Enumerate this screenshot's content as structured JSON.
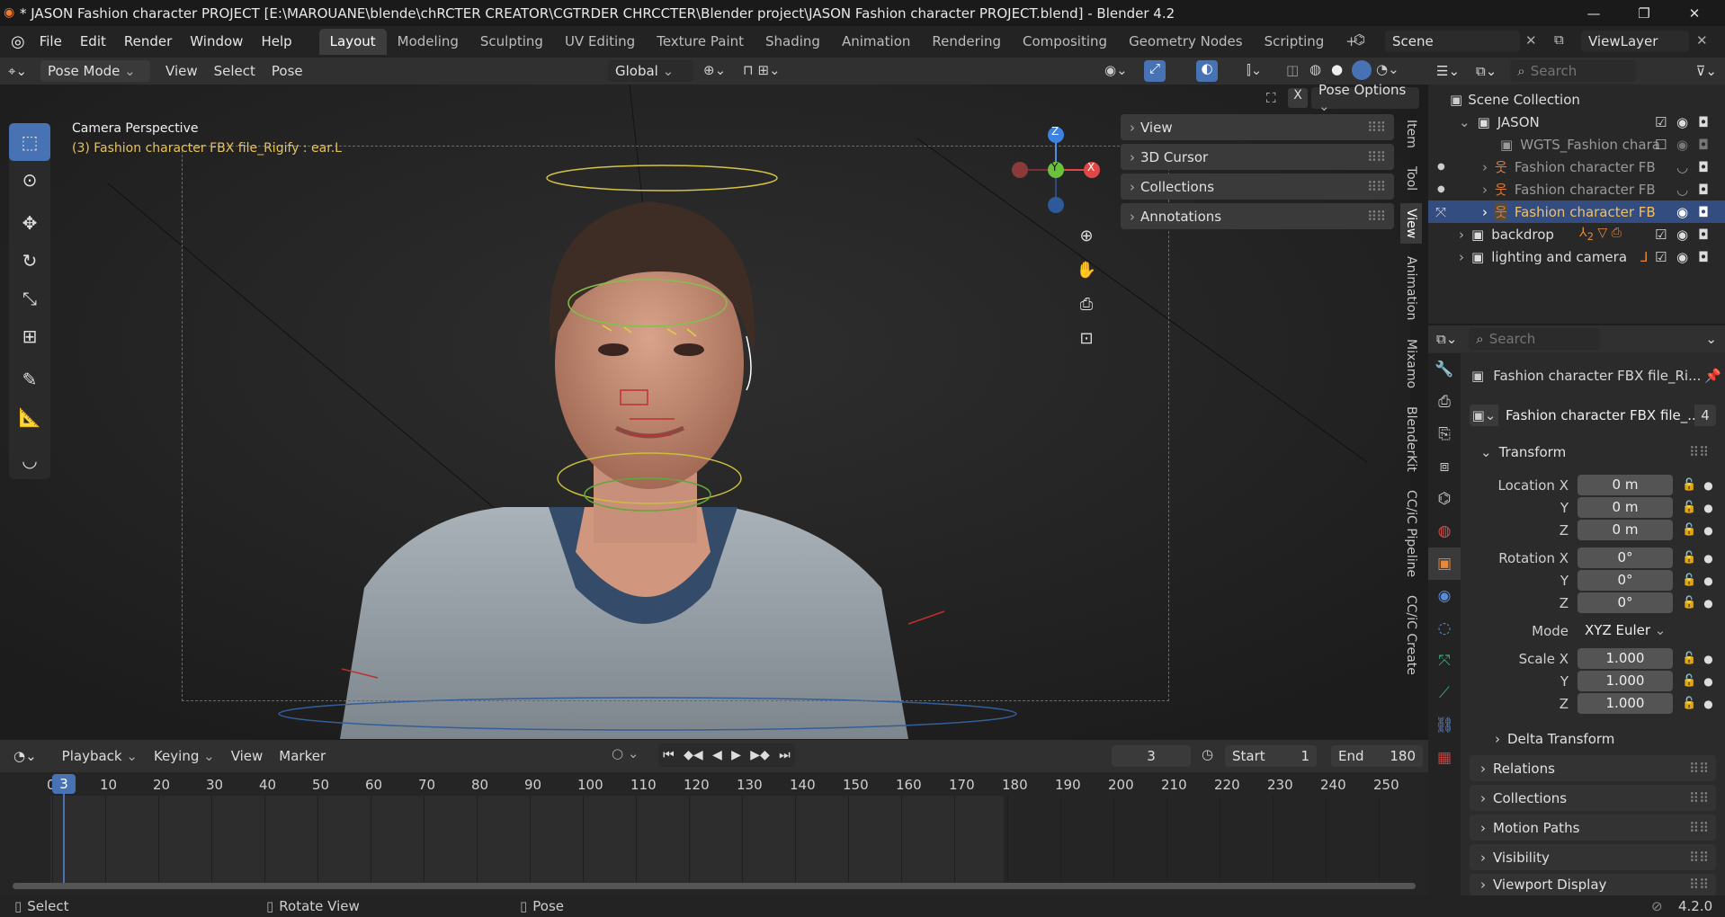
{
  "title": "* JASON Fashion character PROJECT [E:\\MAROUANE\\blende\\chRCTER CREATOR\\CGTRDER CHRCCTER\\Blender project\\JASON Fashion character PROJECT.blend] - Blender 4.2",
  "menu": [
    "File",
    "Edit",
    "Render",
    "Window",
    "Help"
  ],
  "workspaces": [
    "Layout",
    "Modeling",
    "Sculpting",
    "UV Editing",
    "Texture Paint",
    "Shading",
    "Animation",
    "Rendering",
    "Compositing",
    "Geometry Nodes",
    "Scripting"
  ],
  "scene_name": "Scene",
  "viewlayer_name": "ViewLayer",
  "viewport_header": {
    "mode": "Pose Mode",
    "view": "View",
    "select": "Select",
    "pose": "Pose",
    "orientation": "Global",
    "search_placeholder": "Search",
    "pose_options": "Pose Options"
  },
  "viewport": {
    "camera_label": "Camera Perspective",
    "active_label": "(3) Fashion character FBX file_Rigify : ear.L"
  },
  "gizmo": {
    "z": "Z",
    "y": "Y",
    "x": "X"
  },
  "npanel_sections": [
    "View",
    "3D Cursor",
    "Collections",
    "Annotations"
  ],
  "side_tabs": [
    "Item",
    "Tool",
    "View",
    "Animation",
    "Mixamo",
    "BlenderKit",
    "CC/iC Pipeline",
    "CC/iC Create"
  ],
  "outliner": {
    "search_placeholder": "Search",
    "root": "Scene Collection",
    "rows": [
      {
        "label": "JASON",
        "indent": 1
      },
      {
        "label": "WGTS_Fashion chara",
        "indent": 2
      },
      {
        "label": "Fashion character FB",
        "indent": 2
      },
      {
        "label": "Fashion character FB",
        "indent": 2
      },
      {
        "label": "Fashion character FB",
        "indent": 2
      },
      {
        "label": "backdrop",
        "indent": 1
      },
      {
        "label": "lighting and camera",
        "indent": 1
      }
    ],
    "backdrop_badge": "2"
  },
  "properties": {
    "search_placeholder": "Search",
    "object_name": "Fashion character FBX file_Ri...",
    "data_name": "Fashion character FBX file_...",
    "users": "4",
    "transform_label": "Transform",
    "location_label": "Location X",
    "location": [
      "0 m",
      "0 m",
      "0 m"
    ],
    "rotation_label": "Rotation X",
    "rotation": [
      "0°",
      "0°",
      "0°"
    ],
    "mode_label": "Mode",
    "mode_value": "XYZ Euler",
    "scale_label": "Scale X",
    "scale": [
      "1.000",
      "1.000",
      "1.000"
    ],
    "axis_y": "Y",
    "axis_z": "Z",
    "sections": [
      "Delta Transform",
      "Relations",
      "Collections",
      "Motion Paths",
      "Visibility",
      "Viewport Display"
    ]
  },
  "timeline": {
    "playback": "Playback",
    "keying": "Keying",
    "view": "View",
    "marker": "Marker",
    "current_frame": "3",
    "start_label": "Start",
    "start": "1",
    "end_label": "End",
    "end": "180",
    "ticks": [
      "0",
      "10",
      "20",
      "30",
      "40",
      "50",
      "60",
      "70",
      "80",
      "90",
      "100",
      "110",
      "120",
      "130",
      "140",
      "150",
      "160",
      "170",
      "180",
      "190",
      "200",
      "210",
      "220",
      "230",
      "240",
      "250"
    ]
  },
  "status": {
    "select": "Select",
    "rotate": "Rotate View",
    "pose": "Pose",
    "version": "4.2.0"
  },
  "colors": {
    "accent": "#4772b3",
    "selection": "#334d80",
    "active_label": "#e6c35c"
  }
}
